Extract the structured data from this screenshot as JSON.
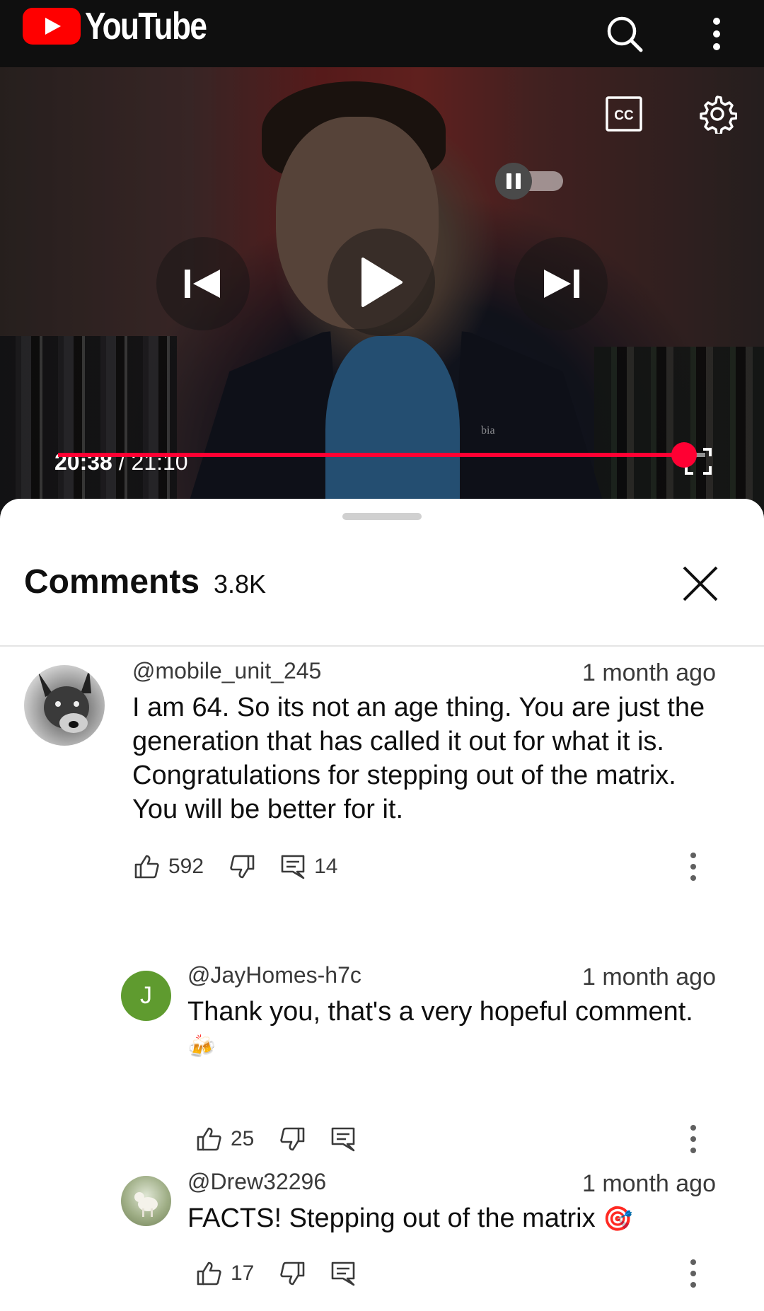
{
  "app": {
    "brand": "YouTube",
    "accent": "#ff0000",
    "progress_color": "#ff0033"
  },
  "topbar": {
    "search_icon": "search-icon",
    "menu_icon": "more-vertical-icon"
  },
  "player": {
    "current_time": "20:38",
    "separator": " / ",
    "duration": "21:10",
    "progress_fraction": 0.967,
    "autoplay": "paused",
    "cc_label": "CC",
    "watermark": "bia"
  },
  "comments": {
    "title": "Comments",
    "count": "3.8K",
    "items": [
      {
        "author": "@mobile_unit_245",
        "time": "1 month ago",
        "text": "I am 64. So its not an age thing. You are just the generation that has called it out for what it is. Congratulations for stepping out of the matrix. You will be better for it.",
        "likes": "592",
        "replies": "14",
        "avatar": "dog-avatar"
      },
      {
        "author": "@JayHomes-h7c",
        "time": "1 month ago",
        "text": "Thank you, that's a very hopeful comment.",
        "emoji": "🍻",
        "likes": "25",
        "avatar_letter": "J",
        "avatar_color": "#5f9b2f"
      },
      {
        "author": "@Drew32296",
        "time": "1 month ago",
        "text": "FACTS! Stepping out of the matrix",
        "emoji": "🎯",
        "likes": "17",
        "avatar": "lamb-avatar"
      }
    ]
  }
}
